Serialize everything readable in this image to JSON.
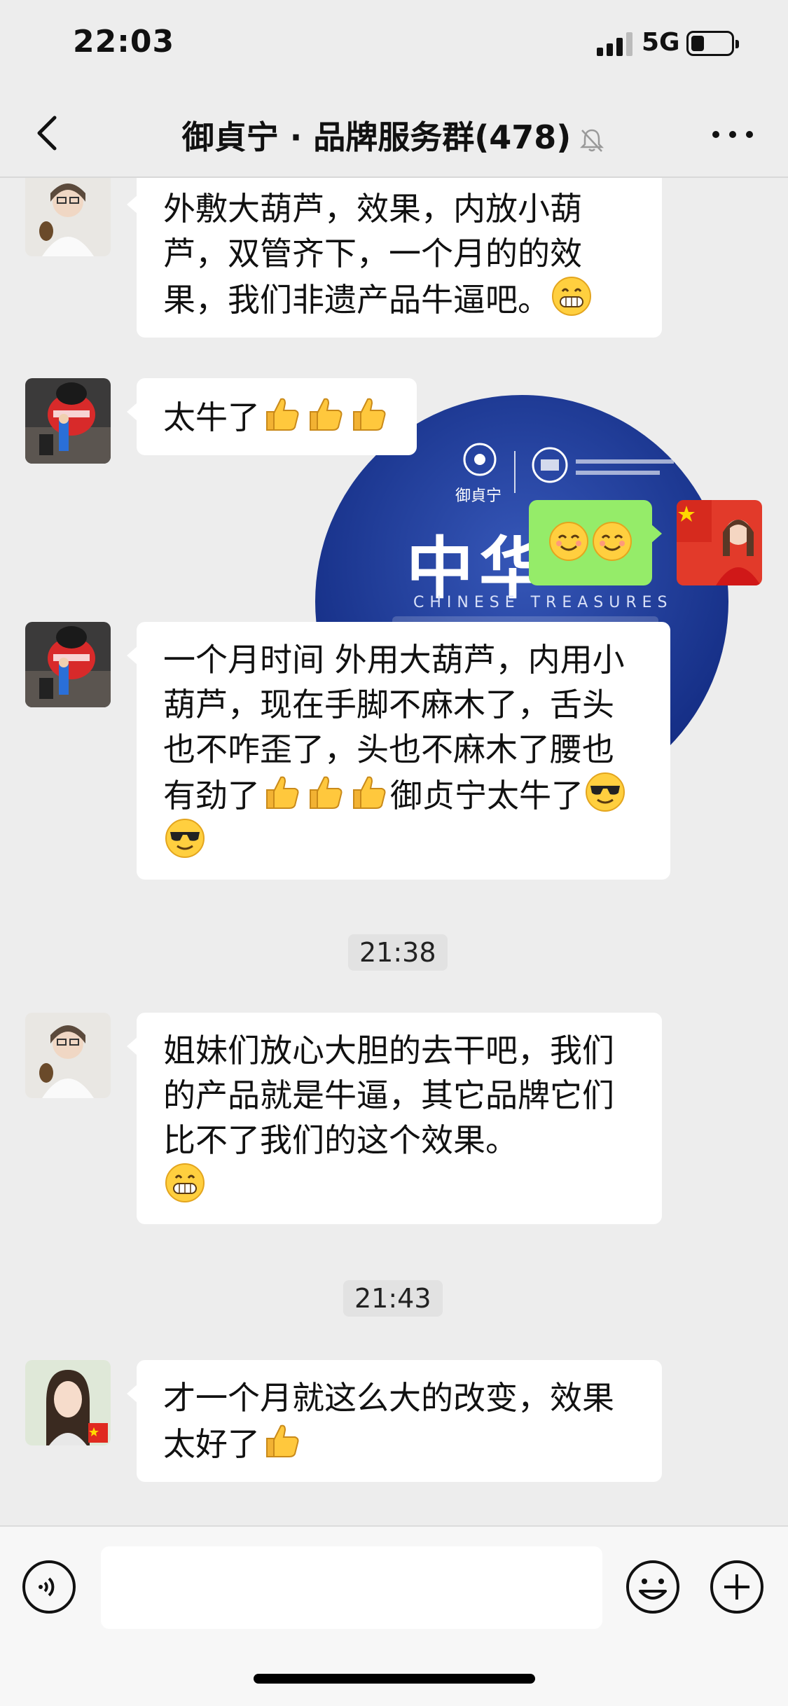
{
  "status_bar": {
    "time": "22:03",
    "network": "5G"
  },
  "header": {
    "title": "御貞宁 · 品牌服务群(478)"
  },
  "messages": [
    {
      "text": "外敷大葫芦，效果，内放小葫芦，双管齐下，一个月的的效果，我们非遗产品牛逼吧。"
    },
    {
      "text": "太牛了"
    },
    {
      "text": "一个月时间 外用大葫芦，内用小葫芦，现在手脚不麻木了，舌头也不咋歪了，头也不麻木了腰也有劲了"
    },
    {
      "text": "御贞宁太牛了"
    },
    {
      "text": "姐妹们放心大胆的去干吧，我们的产品就是牛逼，其它品牌它们比不了我们的这个效果。"
    },
    {
      "text": "才一个月就这么大的改变，效果太好了"
    }
  ],
  "timestamps": [
    "21:38",
    "21:43"
  ],
  "poster": {
    "title": "中华",
    "subtitle": "CHINESE TREASURES",
    "logo_text": "御貞宁"
  },
  "input": {
    "placeholder": ""
  },
  "icons": {
    "back": "chevron-left-icon",
    "mute": "bell-off-icon",
    "more": "more-dots-icon",
    "voice": "voice-icon",
    "emoji": "emoji-icon",
    "plus": "plus-icon",
    "grin": "grin-emoji",
    "thumbs": "thumbs-up-emoji",
    "smile": "smile-emoji",
    "cool": "sunglasses-emoji"
  },
  "colors": {
    "background": "#ededed",
    "bubble_self": "#95ec69",
    "bubble_other": "#ffffff"
  }
}
